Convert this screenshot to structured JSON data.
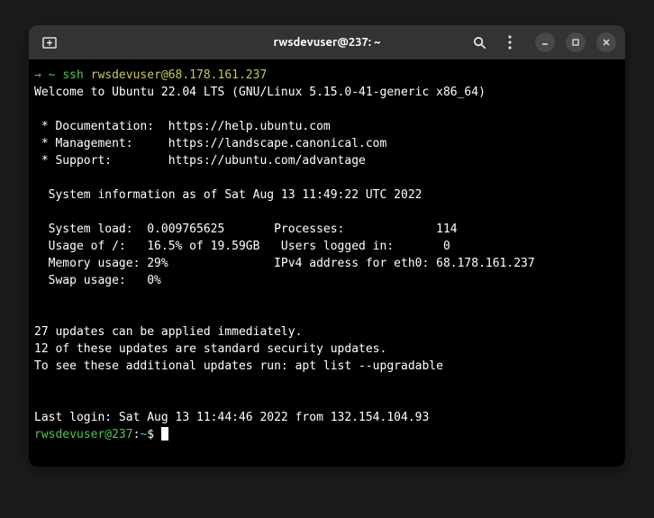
{
  "titlebar": {
    "title": "rwsdevuser@237: ~"
  },
  "terminal": {
    "prompt1_arrow": "→",
    "prompt1_tilde": " ~ ",
    "prompt1_cmd": "ssh ",
    "prompt1_arg": "rwsdevuser@68.178.161.237",
    "welcome": "Welcome to Ubuntu 22.04 LTS (GNU/Linux 5.15.0-41-generic x86_64)",
    "doc_line": " * Documentation:  https://help.ubuntu.com",
    "mgmt_line": " * Management:     https://landscape.canonical.com",
    "support_line": " * Support:        https://ubuntu.com/advantage",
    "sysinfo_header": "  System information as of Sat Aug 13 11:49:22 UTC 2022",
    "row1": "  System load:  0.009765625       Processes:             114",
    "row2": "  Usage of /:   16.5% of 19.59GB   Users logged in:       0",
    "row3": "  Memory usage: 29%               IPv4 address for eth0: 68.178.161.237",
    "row4": "  Swap usage:   0%",
    "updates1": "27 updates can be applied immediately.",
    "updates2": "12 of these updates are standard security updates.",
    "updates3": "To see these additional updates run: apt list --upgradable",
    "lastlogin": "Last login: Sat Aug 13 11:44:46 2022 from 132.154.104.93",
    "prompt2_user": "rwsdevuser@237",
    "prompt2_colon": ":",
    "prompt2_path": "~",
    "prompt2_dollar": "$ "
  }
}
